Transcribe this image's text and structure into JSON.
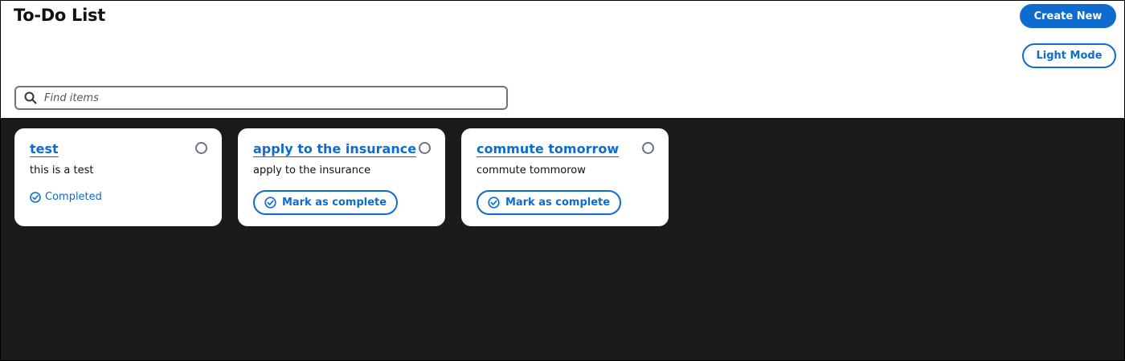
{
  "header": {
    "title": "To-Do List",
    "create_label": "Create New",
    "theme_label": "Light Mode"
  },
  "search": {
    "placeholder": "Find items",
    "value": "",
    "icon": "search-icon"
  },
  "todos": [
    {
      "title": "test",
      "description": "this is a test",
      "completed": true,
      "status_label": "Completed"
    },
    {
      "title": "apply to the insurance",
      "description": "apply to the insurance",
      "completed": false,
      "action_label": "Mark as complete"
    },
    {
      "title": "commute tomorrow",
      "description": "commute tommorow",
      "completed": false,
      "action_label": "Mark as complete"
    }
  ],
  "colors": {
    "accent": "#0e6ccf",
    "background": "#1b1b1b",
    "panel": "#ffffff",
    "border": "#6b7480"
  }
}
